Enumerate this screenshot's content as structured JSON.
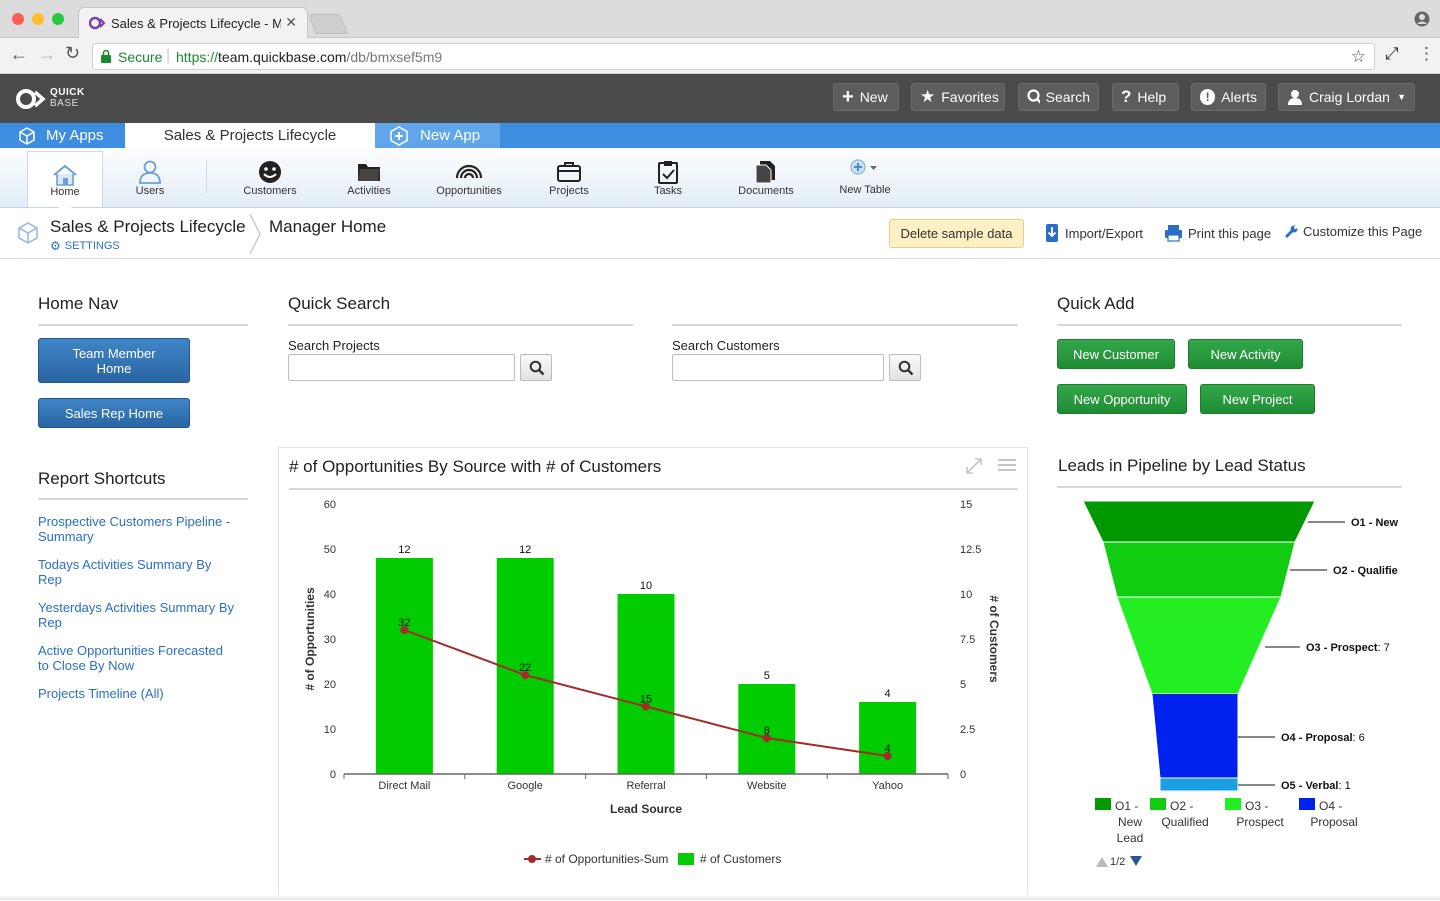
{
  "browser": {
    "tab_title": "Sales & Projects Lifecycle - Ma",
    "secure_label": "Secure",
    "url_prefix": "https://",
    "url_host": "team.quickbase.com",
    "url_path": "/db/bmxsef5m9"
  },
  "header": {
    "logo_top": "QUICK",
    "logo_bottom": "BASE",
    "buttons": {
      "new": "New",
      "favorites": "Favorites",
      "search": "Search",
      "help": "Help",
      "alerts": "Alerts",
      "user": "Craig Lordan"
    }
  },
  "app_tabs": {
    "my_apps": "My Apps",
    "current": "Sales & Projects Lifecycle",
    "new_app": "New App"
  },
  "table_bar": {
    "items": [
      "Home",
      "Users",
      "Customers",
      "Activities",
      "Opportunities",
      "Projects",
      "Tasks",
      "Documents",
      "New Table"
    ]
  },
  "breadcrumb": {
    "app_name": "Sales & Projects Lifecycle",
    "settings": "SETTINGS",
    "page": "Manager Home",
    "delete_sample": "Delete sample data",
    "import_export": "Import/Export",
    "print": "Print this page",
    "customize": "Customize this Page"
  },
  "home_nav": {
    "title": "Home Nav",
    "team_member": "Team Member Home",
    "sales_rep": "Sales Rep Home"
  },
  "report_shortcuts": {
    "title": "Report Shortcuts",
    "links": [
      "Prospective Customers Pipeline - Summary",
      "Todays Activities Summary By Rep",
      "Yesterdays Activities Summary By Rep",
      "Active Opportunities Forecasted to Close By Now",
      "Projects Timeline (All)"
    ]
  },
  "quick_search": {
    "title": "Quick Search",
    "projects_label": "Search Projects",
    "customers_label": "Search Customers",
    "projects_value": "",
    "customers_value": ""
  },
  "quick_add": {
    "title": "Quick Add",
    "new_customer": "New Customer",
    "new_activity": "New Activity",
    "new_opportunity": "New Opportunity",
    "new_project": "New Project"
  },
  "colors": {
    "accent_blue": "#3d8ee0",
    "bar_green": "#00cc00",
    "line_red": "#a52a2a",
    "header_dark": "#4a4a4a"
  },
  "chart_data": [
    {
      "type": "bar",
      "title": "# of Opportunities By Source with # of Customers",
      "xlabel": "Lead Source",
      "ylabel": "# of Opportunities",
      "y2label": "# of Customers",
      "categories": [
        "Direct Mail",
        "Google",
        "Referral",
        "Website",
        "Yahoo"
      ],
      "ylim": [
        0,
        60
      ],
      "y2lim": [
        0,
        15
      ],
      "yticks": [
        "0",
        "10",
        "20",
        "30",
        "40",
        "50",
        "60"
      ],
      "y2ticks": [
        "0",
        "2.5",
        "5",
        "7.5",
        "10",
        "12.5",
        "15"
      ],
      "series": [
        {
          "name": "# of Customers",
          "kind": "bar",
          "axis": "right",
          "values": [
            12,
            12,
            10,
            5,
            4
          ]
        },
        {
          "name": "# of Opportunities-Sum",
          "kind": "line",
          "axis": "left",
          "values": [
            32,
            22,
            15,
            8,
            4
          ]
        }
      ],
      "legend": "bottom",
      "grid": false
    },
    {
      "type": "funnel",
      "title": "Leads in Pipeline by Lead Status",
      "stages": [
        {
          "label": "O1 - New",
          "value": null,
          "color": "#009900"
        },
        {
          "label": "O2 - Qualified",
          "value": null,
          "color": "#11cc11"
        },
        {
          "label": "O3 - Prospect",
          "value": 7,
          "color": "#22ee22"
        },
        {
          "label": "O4 - Proposal",
          "value": 6,
          "color": "#0022ee"
        },
        {
          "label": "O5 - Verbal",
          "value": 1,
          "color": "#1a9fe0"
        }
      ],
      "data_labels": [
        "O1 - New",
        "O2 - Qualifie",
        "O3 - Prospect",
        "O4 - Proposal",
        "O5 - Verbal"
      ],
      "data_values": [
        "",
        "",
        ": 7",
        ": 6",
        ": 1"
      ],
      "legend": [
        {
          "label": "O1 - New Lead",
          "color": "#009900"
        },
        {
          "label": "O2 - Qualified",
          "color": "#11cc11"
        },
        {
          "label": "O3 - Prospect",
          "color": "#22ee22"
        },
        {
          "label": "O4 - Proposal",
          "color": "#0022ee"
        }
      ],
      "legend_page": "1/2"
    }
  ]
}
